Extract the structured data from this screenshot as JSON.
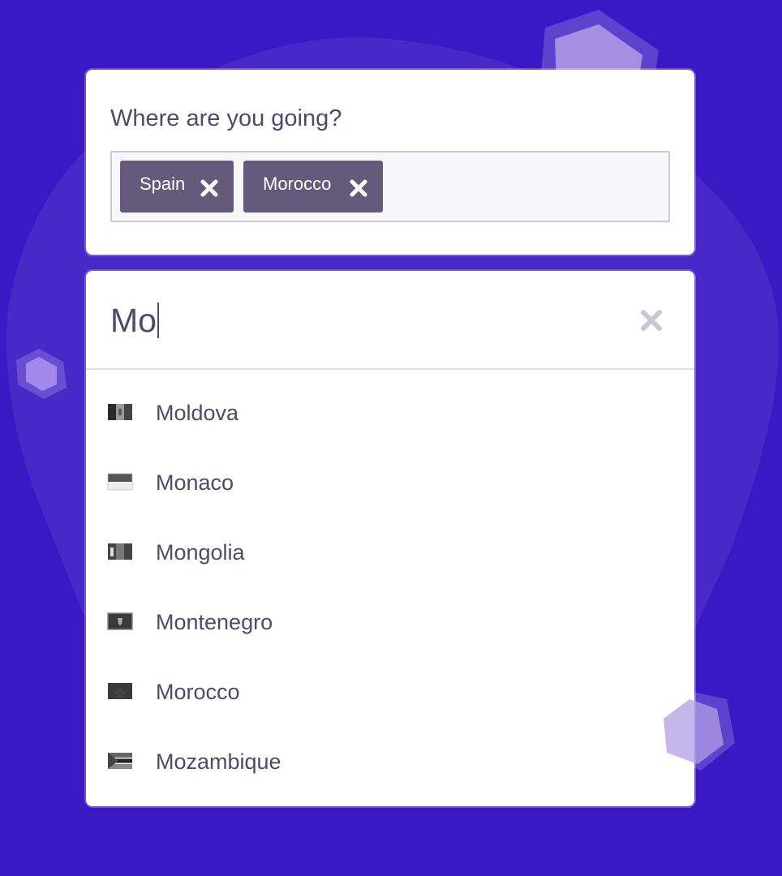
{
  "colors": {
    "background": "#3c18c4",
    "card": "#ffffff",
    "text": "#4f4a68",
    "tag_background": "#655a7c",
    "tag_text": "#ffffff",
    "input_border": "#cbc8da",
    "clear_icon": "#c9c7d3"
  },
  "destination": {
    "question": "Where are you going?",
    "selected_tags": [
      {
        "label": "Spain",
        "icon": "close-icon"
      },
      {
        "label": "Morocco",
        "icon": "close-icon"
      }
    ]
  },
  "search": {
    "value": "Mo",
    "clear_icon": "close-icon"
  },
  "results": [
    {
      "name": "Moldova",
      "icon": "moldova-flag-icon"
    },
    {
      "name": "Monaco",
      "icon": "monaco-flag-icon"
    },
    {
      "name": "Mongolia",
      "icon": "mongolia-flag-icon"
    },
    {
      "name": "Montenegro",
      "icon": "montenegro-flag-icon"
    },
    {
      "name": "Morocco",
      "icon": "morocco-flag-icon"
    },
    {
      "name": "Mozambique",
      "icon": "mozambique-flag-icon"
    }
  ]
}
